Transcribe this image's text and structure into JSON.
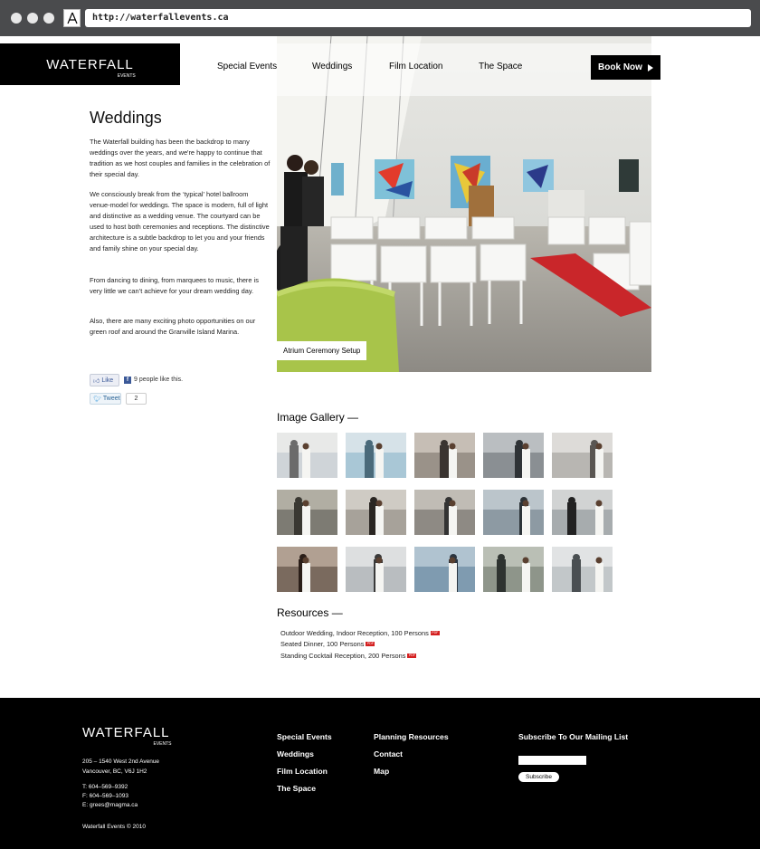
{
  "browser": {
    "url": "http://waterfallevents.ca"
  },
  "logo": {
    "main": "WATERFALL",
    "sub": "EVENTS"
  },
  "nav": {
    "items": [
      "Special Events",
      "Weddings",
      "Film Location",
      "The Space"
    ],
    "book_label": "Book Now"
  },
  "page": {
    "title": "Weddings",
    "paragraphs": [
      "The Waterfall building has been the backdrop to many weddings over the years, and we're happy to continue that tradition as we host couples and families in the celebration of their special day.",
      "We consciously break from the ‘typical’ hotel ballroom venue-model for weddings. The space is modern, full of light and distinctive as a wedding venue. The courtyard can be used to host both ceremonies and receptions. The distinctive architecture is a subtle backdrop to let you and your friends and family shine on your special day.",
      "From dancing to dining, from marquees to music, there is very little we can’t achieve for your dream wedding day.",
      "Also, there are many exciting photo opportunities on our green roof and around the Granville Island Marina."
    ],
    "hero_caption": "Atrium Ceremony Setup"
  },
  "social": {
    "like_label": "Like",
    "like_text": "9 people like this.",
    "tweet_label": "Tweet",
    "tweet_count": "2"
  },
  "gallery": {
    "title": "Image Gallery —",
    "count": 15
  },
  "resources": {
    "title": "Resources —",
    "pdf_label": "PDF",
    "items": [
      "Outdoor Wedding, Indoor Reception, 100 Persons",
      "Seated Dinner, 100 Persons",
      "Standing Cocktail Reception, 200 Persons"
    ]
  },
  "footer": {
    "address_1": "205 – 1540 West 2nd Avenue",
    "address_2": "Vancouver, BC, V6J 1H2",
    "phone": "T: 604–569–9392",
    "fax": "F: 604–569–1093",
    "email": "E: grees@magma.ca",
    "copyright": "Waterfall Events  ©  2010",
    "col1": [
      "Special Events",
      "Weddings",
      "Film Location",
      "The Space"
    ],
    "col2": [
      "Planning Resources",
      "Contact",
      "Map"
    ],
    "subscribe_title": "Subscribe To Our Mailing List",
    "subscribe_button": "Subscribe"
  }
}
